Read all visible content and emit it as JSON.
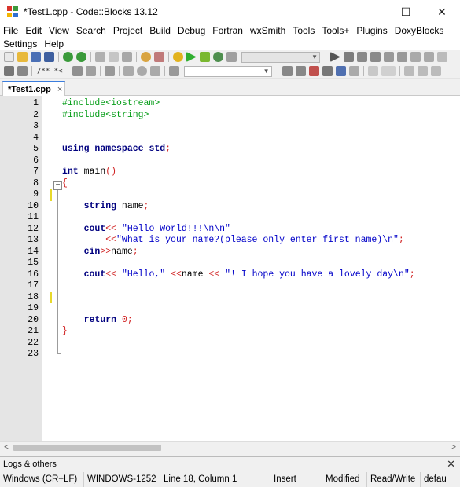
{
  "window": {
    "title": "*Test1.cpp - Code::Blocks 13.12",
    "minimize_glyph": "—",
    "maximize_glyph": "☐",
    "close_glyph": "✕"
  },
  "menu": {
    "row1": [
      "File",
      "Edit",
      "View",
      "Search",
      "Project",
      "Build",
      "Debug",
      "Fortran",
      "wxSmith",
      "Tools",
      "Tools+",
      "Plugins",
      "DoxyBlocks"
    ],
    "row2": [
      "Settings",
      "Help"
    ]
  },
  "toolbar": {
    "comment_tool": "/** *<",
    "icon_names": [
      "new-file-icon",
      "open-icon",
      "save-icon",
      "save-all-icon",
      "undo-icon",
      "redo-icon",
      "cut-icon",
      "copy-icon",
      "paste-icon",
      "find-icon",
      "replace-icon",
      "build-icon",
      "run-icon",
      "build-run-icon",
      "rebuild-icon",
      "abort-icon",
      "debug-icon",
      "step-icon"
    ]
  },
  "tab": {
    "label": "*Test1.cpp",
    "close_glyph": "×"
  },
  "editor": {
    "lines": [
      [
        [
          "pre",
          "#include<iostream>"
        ]
      ],
      [
        [
          "pre",
          "#include<string>"
        ]
      ],
      [],
      [],
      [
        [
          "kw",
          "using"
        ],
        [
          "txt",
          " "
        ],
        [
          "kw",
          "namespace"
        ],
        [
          "txt",
          " "
        ],
        [
          "kw",
          "std"
        ],
        [
          "op",
          ";"
        ]
      ],
      [],
      [
        [
          "kw",
          "int"
        ],
        [
          "txt",
          " main"
        ],
        [
          "op",
          "()"
        ]
      ],
      [
        [
          "op",
          "{"
        ]
      ],
      [],
      [
        [
          "txt",
          "    "
        ],
        [
          "kw",
          "string"
        ],
        [
          "txt",
          " name"
        ],
        [
          "op",
          ";"
        ]
      ],
      [],
      [
        [
          "txt",
          "    "
        ],
        [
          "kw",
          "cout"
        ],
        [
          "op",
          "<<"
        ],
        [
          "txt",
          " "
        ],
        [
          "str",
          "\"Hello World!!!\\n\\n\""
        ]
      ],
      [
        [
          "txt",
          "        "
        ],
        [
          "op",
          "<<"
        ],
        [
          "str",
          "\"What is your name?(please only enter first name)\\n\""
        ],
        [
          "op",
          ";"
        ]
      ],
      [
        [
          "txt",
          "    "
        ],
        [
          "kw",
          "cin"
        ],
        [
          "op",
          ">>"
        ],
        [
          "txt",
          "name"
        ],
        [
          "op",
          ";"
        ]
      ],
      [],
      [
        [
          "txt",
          "    "
        ],
        [
          "kw",
          "cout"
        ],
        [
          "op",
          "<<"
        ],
        [
          "txt",
          " "
        ],
        [
          "str",
          "\"Hello,\""
        ],
        [
          "txt",
          " "
        ],
        [
          "op",
          "<<"
        ],
        [
          "txt",
          "name "
        ],
        [
          "op",
          "<<"
        ],
        [
          "txt",
          " "
        ],
        [
          "str",
          "\"! I hope you have a lovely day\\n\""
        ],
        [
          "op",
          ";"
        ]
      ],
      [],
      [],
      [],
      [
        [
          "txt",
          "    "
        ],
        [
          "kw",
          "return"
        ],
        [
          "txt",
          " "
        ],
        [
          "num",
          "0"
        ],
        [
          "op",
          ";"
        ]
      ],
      [
        [
          "op",
          "}"
        ]
      ],
      []
    ],
    "line_numbers": [
      "1",
      "2",
      "3",
      "4",
      "5",
      "6",
      "7",
      "8",
      "9",
      "10",
      "11",
      "12",
      "13",
      "14",
      "15",
      "16",
      "17",
      "18",
      "19",
      "20",
      "21",
      "22",
      "23"
    ],
    "changed_lines": [
      9,
      18
    ],
    "fold_marker": "−"
  },
  "scrollbar": {
    "left_arrow": "<",
    "right_arrow": ">"
  },
  "logs": {
    "label": "Logs & others",
    "close_glyph": "✕"
  },
  "status": {
    "line_endings": "Windows (CR+LF)",
    "encoding": "WINDOWS-1252",
    "position": "Line 18, Column 1",
    "mode": "Insert",
    "modified": "Modified",
    "access": "Read/Write",
    "extra": "defau"
  },
  "colors": {
    "preprocessor": "#0a9f1c",
    "keyword": "#00007f",
    "string": "#0000c8",
    "operator": "#d02020",
    "change_marker": "#e8d92b",
    "tab_accent": "#3b7ddd"
  }
}
